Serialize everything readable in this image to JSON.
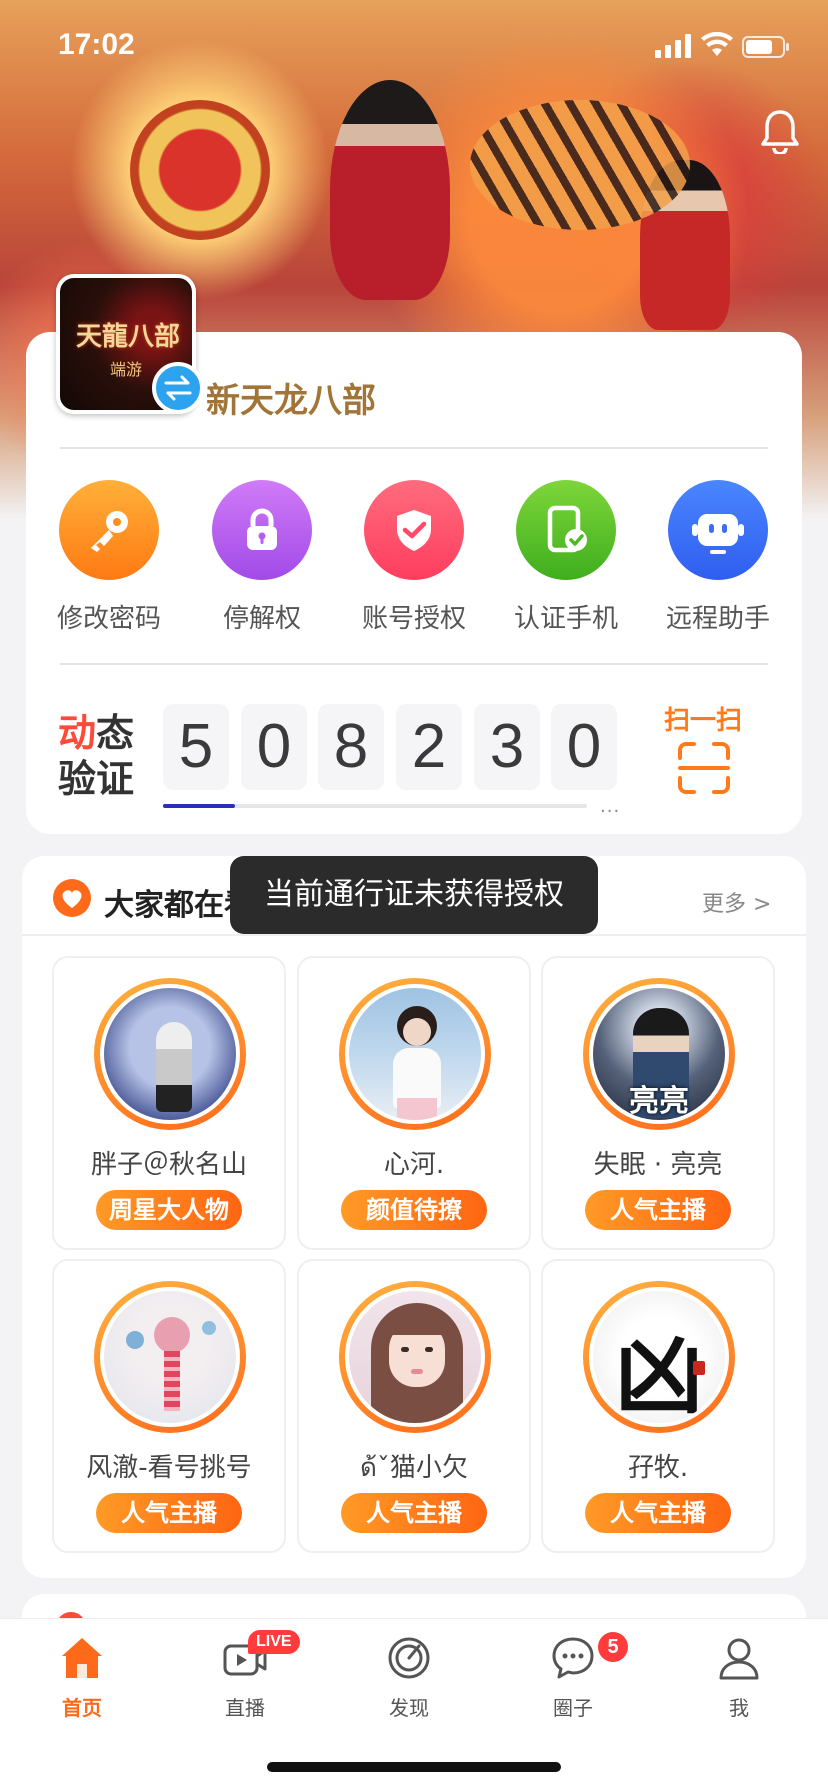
{
  "status_bar": {
    "time": "17:02"
  },
  "account": {
    "game_name": "新天龙八部",
    "logo_title": "天龍八部",
    "logo_sub": "端游"
  },
  "actions": [
    {
      "label": "修改密码",
      "icon": "key-icon",
      "color": "#ff8a1e"
    },
    {
      "label": "停解权",
      "icon": "lock-icon",
      "color": "#b45cf2"
    },
    {
      "label": "账号授权",
      "icon": "shield-check-icon",
      "color": "#ff4a6a"
    },
    {
      "label": "认证手机",
      "icon": "phone-check-icon",
      "color": "#55c22a"
    },
    {
      "label": "远程助手",
      "icon": "robot-icon",
      "color": "#3a6cf5"
    }
  ],
  "dynamic_code": {
    "label_line1_accent": "动",
    "label_line1_rest": "态",
    "label_line2": "验证",
    "digits": [
      "5",
      "0",
      "8",
      "2",
      "3",
      "0"
    ],
    "progress": 0.17,
    "more": "...",
    "scan_label": "扫一扫"
  },
  "section": {
    "title": "大家都在看",
    "more": "更多 >"
  },
  "toast": "当前通行证未获得授权",
  "users": [
    {
      "name": "胖子＠秋名山",
      "tag": "周星大人物"
    },
    {
      "name": "心河.",
      "tag": "颜值待撩"
    },
    {
      "name": "失眠 · 亮亮",
      "tag": "人气主播",
      "avatar_text": "亮亮"
    },
    {
      "name": "风澈-看号挑号",
      "tag": "人气主播"
    },
    {
      "name": "ด้ˇ猫小欠",
      "tag": "人气主播"
    },
    {
      "name": "孖牧.",
      "tag": "人气主播",
      "avatar_text": "凶"
    }
  ],
  "tabs": [
    {
      "label": "首页",
      "icon": "home-icon",
      "active": true
    },
    {
      "label": "直播",
      "icon": "live-video-icon",
      "badge": "LIVE"
    },
    {
      "label": "发现",
      "icon": "discover-icon"
    },
    {
      "label": "圈子",
      "icon": "chat-bubble-icon",
      "badge": "5"
    },
    {
      "label": "我",
      "icon": "profile-icon"
    }
  ],
  "colors": {
    "accent": "#ff6a1a",
    "gold_text": "#a17437",
    "live_red": "#ff3b3b"
  }
}
